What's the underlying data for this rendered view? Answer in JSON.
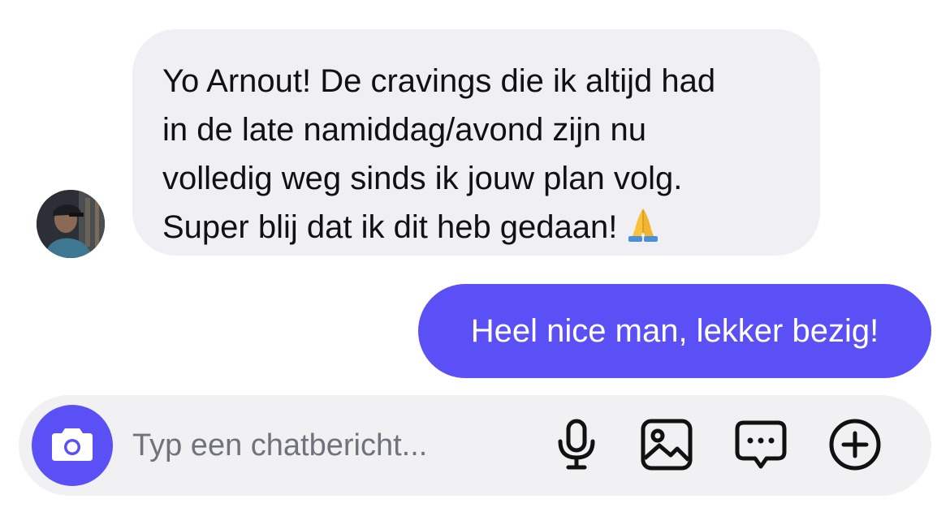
{
  "messages": [
    {
      "direction": "incoming",
      "lines": [
        "Yo Arnout! De cravings die ik altijd had",
        "in de late namiddag/avond zijn nu",
        "volledig weg sinds ik jouw plan volg.",
        "Super blij dat ik dit heb gedaan!"
      ],
      "emoji": "folded-hands"
    },
    {
      "direction": "outgoing",
      "text": "Heel nice man, lekker bezig!"
    }
  ],
  "composer": {
    "placeholder": "Typ een chatbericht...",
    "icons": [
      "camera-icon",
      "microphone-icon",
      "image-icon",
      "message-more-icon",
      "plus-circle-icon"
    ]
  },
  "colors": {
    "accent": "#5a50f6",
    "incoming_bubble": "#efeff4",
    "composer_bg": "#f1f1f4",
    "placeholder": "#70727c"
  }
}
